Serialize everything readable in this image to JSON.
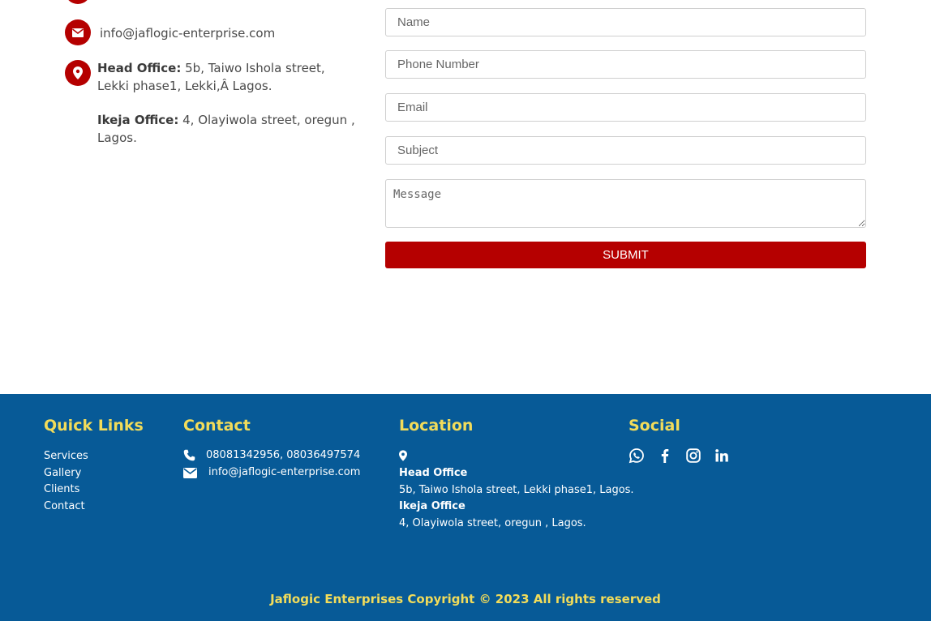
{
  "contact_info": {
    "email": "info@jaflogic-enterprise.com",
    "head_office_label": "Head Office:",
    "head_office_address": " 5b, Taiwo Ishola street, Lekki phase1, Lekki,Â Lagos.",
    "ikeja_office_label": "Ikeja Office:",
    "ikeja_office_address": " 4, Olayiwola street, oregun , Lagos."
  },
  "form": {
    "name_placeholder": "Name",
    "phone_placeholder": "Phone Number",
    "email_placeholder": "Email",
    "subject_placeholder": "Subject",
    "message_placeholder": "Message",
    "submit_label": "SUBMIT",
    "accent_color": "#b50000"
  },
  "footer": {
    "background_color": "#075a97",
    "heading_color": "#f2dc5a",
    "quick_links": {
      "heading": "Quick Links",
      "items": [
        {
          "label": "Services"
        },
        {
          "label": "Gallery"
        },
        {
          "label": "Clients"
        },
        {
          "label": "Contact"
        }
      ]
    },
    "contact": {
      "heading": "Contact",
      "phones": "08081342956, 08036497574",
      "email": "info@jaflogic-enterprise.com",
      "phone_icon": "phone-icon",
      "email_icon": "envelope-icon"
    },
    "location": {
      "heading": "Location",
      "icon": "map-marker-icon",
      "head_office_title": "Head Office",
      "head_office_address": "5b, Taiwo Ishola street, Lekki phase1, Lagos.",
      "ikeja_office_title": "Ikeja Office",
      "ikeja_office_address": "4, Olayiwola street, oregun , Lagos."
    },
    "social": {
      "heading": "Social",
      "icons": [
        "whatsapp-icon",
        "facebook-icon",
        "instagram-icon",
        "linkedin-icon"
      ]
    },
    "copyright": "Jaflogic Enterprises Copyright © 2023 All rights reserved"
  }
}
